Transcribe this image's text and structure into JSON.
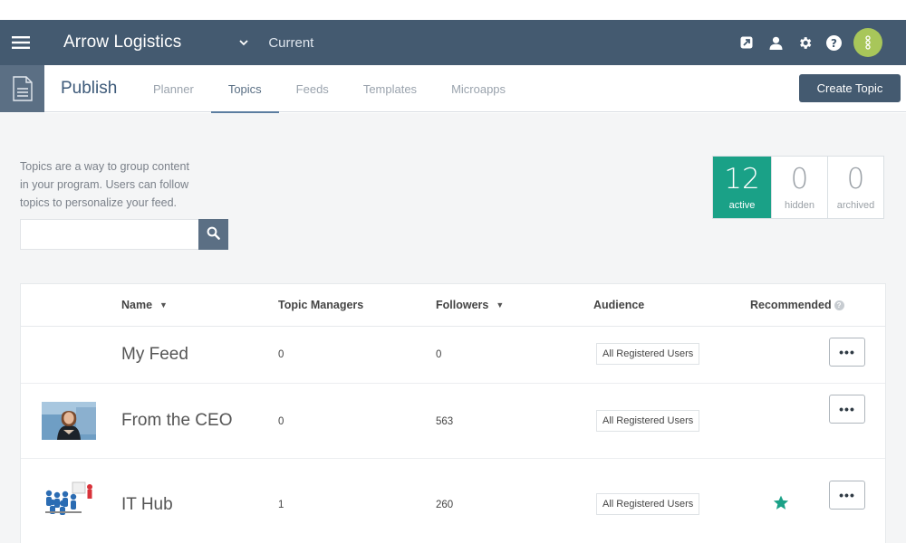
{
  "header": {
    "org_name": "Arrow Logistics",
    "env_label": "Current",
    "colors": {
      "bar": "#445a70",
      "avatar": "#a8c65a"
    },
    "icons": [
      "menu-icon",
      "external-link-icon",
      "user-icon",
      "gear-icon",
      "help-icon",
      "avatar-icon"
    ]
  },
  "subnav": {
    "section_title": "Publish",
    "tabs": [
      {
        "label": "Planner",
        "active": false
      },
      {
        "label": "Topics",
        "active": true
      },
      {
        "label": "Feeds",
        "active": false
      },
      {
        "label": "Templates",
        "active": false
      },
      {
        "label": "Microapps",
        "active": false
      }
    ],
    "create_label": "Create Topic"
  },
  "intro": {
    "text": "Topics are a way to group content in your program. Users can follow topics to personalize your feed."
  },
  "search": {
    "value": "",
    "placeholder": ""
  },
  "stats": [
    {
      "count": "12",
      "label": "active",
      "selected": true
    },
    {
      "count": "0",
      "label": "hidden",
      "selected": false
    },
    {
      "count": "0",
      "label": "archived",
      "selected": false
    }
  ],
  "table": {
    "columns": {
      "name": "Name",
      "managers": "Topic Managers",
      "followers": "Followers",
      "audience": "Audience",
      "recommended": "Recommended"
    },
    "rows": [
      {
        "name": "My Feed",
        "managers": "0",
        "followers": "0",
        "audience": "All Registered Users",
        "recommended": false,
        "thumb": "none"
      },
      {
        "name": "From the CEO",
        "managers": "0",
        "followers": "563",
        "audience": "All Registered Users",
        "recommended": false,
        "thumb": "ceo-photo"
      },
      {
        "name": "IT Hub",
        "managers": "1",
        "followers": "260",
        "audience": "All Registered Users",
        "recommended": true,
        "thumb": "team-figures"
      }
    ],
    "menu_label": "•••",
    "accent": "#1aa187"
  }
}
